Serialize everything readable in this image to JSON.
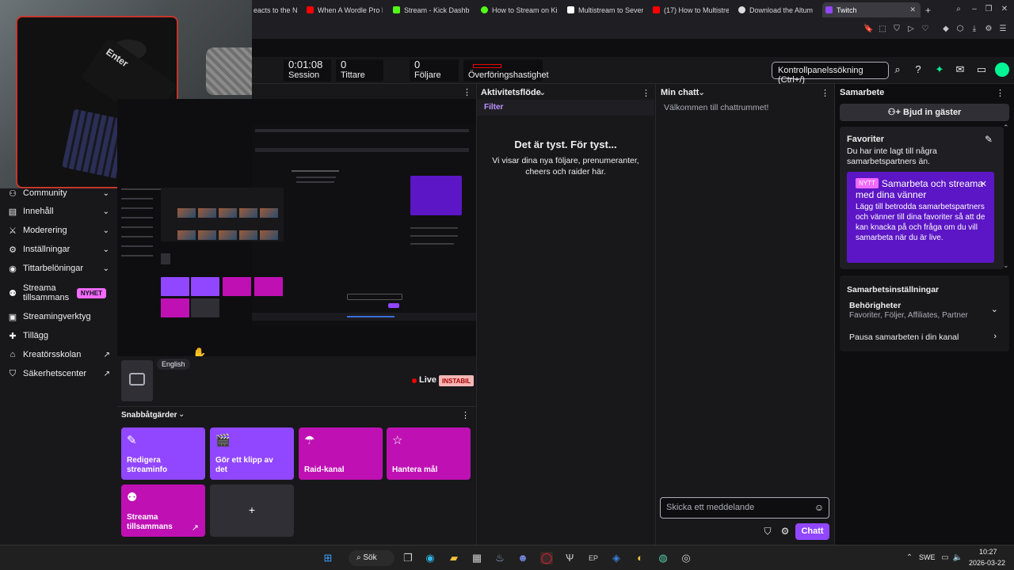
{
  "browser": {
    "tabs": [
      {
        "label": "eacts to the N",
        "color": "#444"
      },
      {
        "label": "When A Wordle Pro P",
        "color": "#ff0000"
      },
      {
        "label": "Stream - Kick Dashb",
        "color": "#53fc18"
      },
      {
        "label": "How to Stream on Ki",
        "color": "#53fc18"
      },
      {
        "label": "Multistream to Sever",
        "color": "#ffffff"
      },
      {
        "label": "(17) How to Multistre",
        "color": "#ff0000"
      },
      {
        "label": "Download the Altum",
        "color": "#dddddd"
      },
      {
        "label": "Twitch",
        "color": "#9147ff"
      }
    ],
    "new_tab": "+"
  },
  "topbar": {
    "session_value": "0:01:08",
    "session_label": "Session",
    "viewers_value": "0",
    "viewers_label": "Tittare",
    "followers_value": "0",
    "followers_label": "Följare",
    "bitrate_label": "Överföringshastighet",
    "search_placeholder": "Kontrollpanelssökning (Ctrl+/)"
  },
  "sidebar": {
    "items": [
      {
        "label": "Community",
        "icon": "community-icon"
      },
      {
        "label": "Innehåll",
        "icon": "content-icon"
      },
      {
        "label": "Moderering",
        "icon": "moderation-icon"
      },
      {
        "label": "Inställningar",
        "icon": "settings-icon"
      },
      {
        "label": "Tittarbelöningar",
        "icon": "rewards-icon"
      },
      {
        "label": "Streama tillsammans",
        "icon": "stream-together-icon",
        "badge": "NYHET"
      },
      {
        "label": "Streamingverktyg",
        "icon": "streaming-tools-icon"
      },
      {
        "label": "Tillägg",
        "icon": "extensions-icon"
      },
      {
        "label": "Kreatörsskolan",
        "icon": "creator-school-icon"
      },
      {
        "label": "Säkerhetscenter",
        "icon": "safety-center-icon"
      }
    ]
  },
  "stream": {
    "language": "English",
    "live_label": "Live",
    "status_badge": "INSTABIL"
  },
  "quick_actions": {
    "title": "Snabbåtgärder",
    "items": [
      {
        "label": "Redigera streaminfo",
        "icon": "pencil-icon",
        "color": "#9147ff"
      },
      {
        "label": "Gör ett klipp av det",
        "icon": "clip-icon",
        "color": "#9147ff"
      },
      {
        "label": "Raid-kanal",
        "icon": "raid-icon",
        "color": "#bf10b4"
      },
      {
        "label": "Hantera mål",
        "icon": "star-icon",
        "color": "#bf10b4"
      },
      {
        "label": "Streama tillsammans",
        "icon": "stream-together-icon",
        "color": "#bf10b4"
      }
    ],
    "add_label": "+"
  },
  "activity": {
    "title": "Aktivitetsflöde",
    "filter": "Filter",
    "empty_title": "Det är tyst. För tyst...",
    "empty_text": "Vi visar dina nya följare, prenumeranter, cheers och raider här."
  },
  "chat": {
    "title": "Min chatt",
    "welcome": "Välkommen till chattrummet!",
    "input_placeholder": "Skicka ett meddelande",
    "send_label": "Chatt"
  },
  "collab": {
    "title": "Samarbete",
    "invite_label": "Bjud in gäster",
    "favorites_title": "Favoriter",
    "favorites_text": "Du har inte lagt till några samarbetspartners än.",
    "promo_badge": "NYTT",
    "promo_title": "Samarbeta och streama med dina vänner",
    "promo_text": "Lägg till betrodda samarbetspartners och vänner till dina favoriter så att de kan knacka på och fråga om du vill samarbeta när du är live.",
    "settings_title": "Samarbetsinställningar",
    "permissions_title": "Behörigheter",
    "permissions_value": "Favoriter, Följer, Affiliates, Partner",
    "pause_label": "Pausa samarbeten i din kanal"
  },
  "webcam": {
    "key_label": "Enter"
  },
  "taskbar": {
    "search_label": "Sök",
    "lang": "SWE",
    "time": "10:27",
    "date": "2026-03-22"
  }
}
